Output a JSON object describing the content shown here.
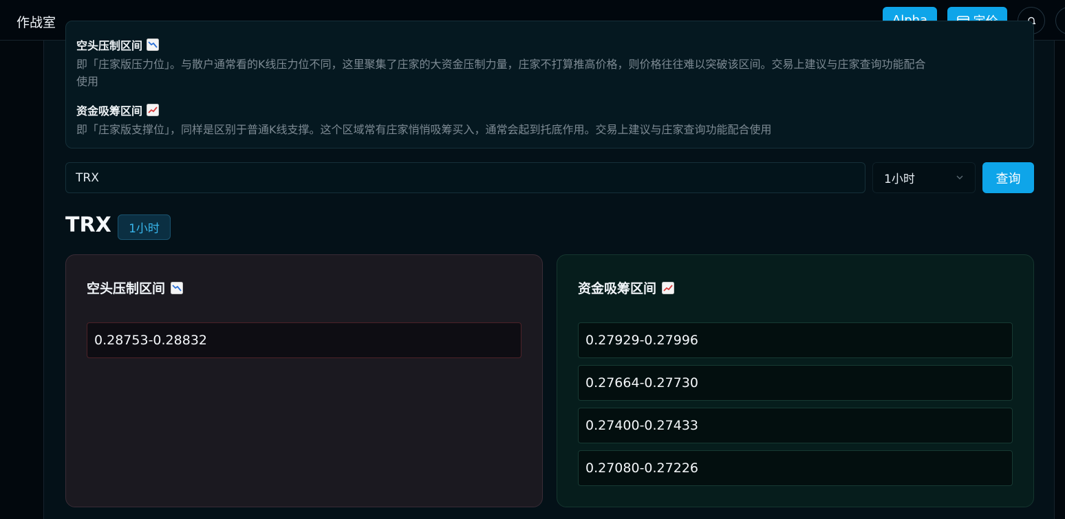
{
  "header": {
    "title": "作战室",
    "alpha_label": "Alpha",
    "pricing_label": "定价",
    "icons": {
      "pricing": "card-icon",
      "notifications": "bell-icon",
      "user": "user-avatar"
    }
  },
  "info": {
    "short_title": "空头压制区间",
    "short_desc_line1": "即「庄家版压力位」。与散户通常看的K线压力位不同，这里聚集了庄家的大资金压制力量，庄家不打算推高价格，则价格往往难以突破该区间。交易上建议与庄家查询功能配合",
    "short_desc_line2": "使用",
    "long_title": "资金吸筹区间",
    "long_desc": "即「庄家版支撑位」，同样是区别于普通K线支撑。这个区域常有庄家悄悄吸筹买入，通常会起到托底作用。交易上建议与庄家查询功能配合使用",
    "icons": {
      "short": "chart-decreasing-icon",
      "long": "chart-increasing-icon"
    }
  },
  "query": {
    "symbol_value": "TRX",
    "interval_value": "1小时",
    "submit_label": "查询"
  },
  "result": {
    "symbol": "TRX",
    "interval_badge": "1小时",
    "short_zone": {
      "title": "空头压制区间",
      "ranges": [
        "0.28753-0.28832"
      ]
    },
    "long_zone": {
      "title": "资金吸筹区间",
      "ranges": [
        "0.27929-0.27996",
        "0.27664-0.27730",
        "0.27400-0.27433",
        "0.27080-0.27226"
      ]
    }
  },
  "colors": {
    "accent": "#0ea5e9",
    "background": "#041118",
    "short_border": "#4d2228",
    "long_border": "#173a33"
  }
}
